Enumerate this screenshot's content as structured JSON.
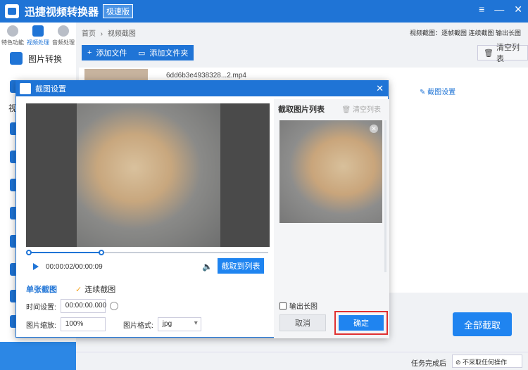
{
  "app": {
    "name": "迅捷视频转换器",
    "badge": "极速版"
  },
  "window_controls": {
    "menu": "≡",
    "minimize": "—",
    "close": "✕"
  },
  "top_tabs": [
    {
      "label": "特色功能"
    },
    {
      "label": "视频处理"
    },
    {
      "label": "音频处理"
    }
  ],
  "sidebar": {
    "image_convert": "图片转换",
    "partial_label": "视"
  },
  "breadcrumb": {
    "home": "首页",
    "sep": "›",
    "current": "视频截图"
  },
  "modes_links": {
    "text": "视频截图：逐帧截图 连续截图 输出长图"
  },
  "toolbar": {
    "add_file": "添加文件",
    "add_folder": "添加文件夹",
    "clear_list": "清空列表"
  },
  "file": {
    "name": "6dd6b3e4938328...2.mp4",
    "crop_setting": "截图设置"
  },
  "bottom": {
    "convert_all": "全部截取",
    "after_done_label": "任务完成后",
    "after_done_value": "不采取任何操作"
  },
  "dialog": {
    "title": "截图设置",
    "close": "✕",
    "time_display": "00:00:02/00:00:09",
    "snap_to_list": "截取到列表",
    "mode_single": "单张截图",
    "mode_continuous": "连续截图",
    "time_label": "时间设置:",
    "time_value": "00:00:00.000",
    "zoom_label": "图片缩放:",
    "zoom_value": "100%",
    "format_label": "图片格式:",
    "format_value": "jpg",
    "list_title": "截取图片列表",
    "clear_list": "清空列表",
    "output_long": "输出长图",
    "cancel": "取消",
    "confirm": "确定"
  },
  "playback": {
    "progress_fraction": 0.31
  }
}
